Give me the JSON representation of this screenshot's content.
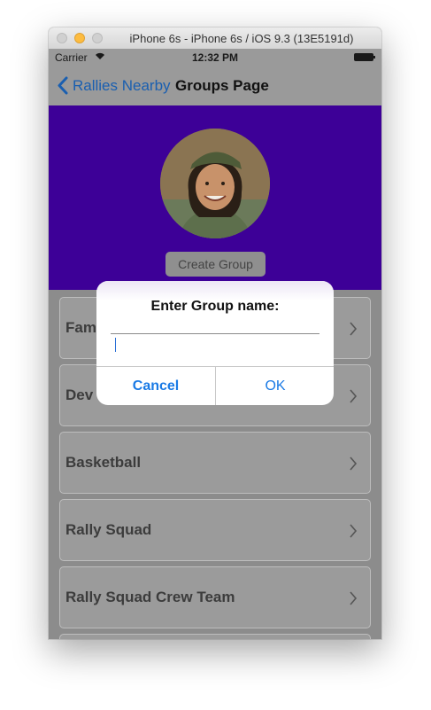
{
  "window": {
    "title": "iPhone 6s - iPhone 6s / iOS 9.3 (13E5191d)"
  },
  "status_bar": {
    "carrier": "Carrier",
    "time": "12:32 PM"
  },
  "nav": {
    "back_label": "Rallies Nearby",
    "title": "Groups Page"
  },
  "header": {
    "create_group_label": "Create Group"
  },
  "groups": [
    {
      "name": "Fam"
    },
    {
      "name": "Dev"
    },
    {
      "name": "Basketball"
    },
    {
      "name": "Rally Squad"
    },
    {
      "name": "Rally Squad Crew Team"
    }
  ],
  "alert": {
    "title": "Enter Group name:",
    "input_value": "",
    "cancel_label": "Cancel",
    "ok_label": "OK"
  },
  "colors": {
    "header_bg": "#3d0097",
    "tint_blue": "#1a7ae5",
    "overlay_gray": "#9a9a9a"
  },
  "icons": [
    "wifi-icon",
    "battery-icon",
    "back-chevron-icon",
    "chevron-right-icon",
    "avatar-photo"
  ]
}
